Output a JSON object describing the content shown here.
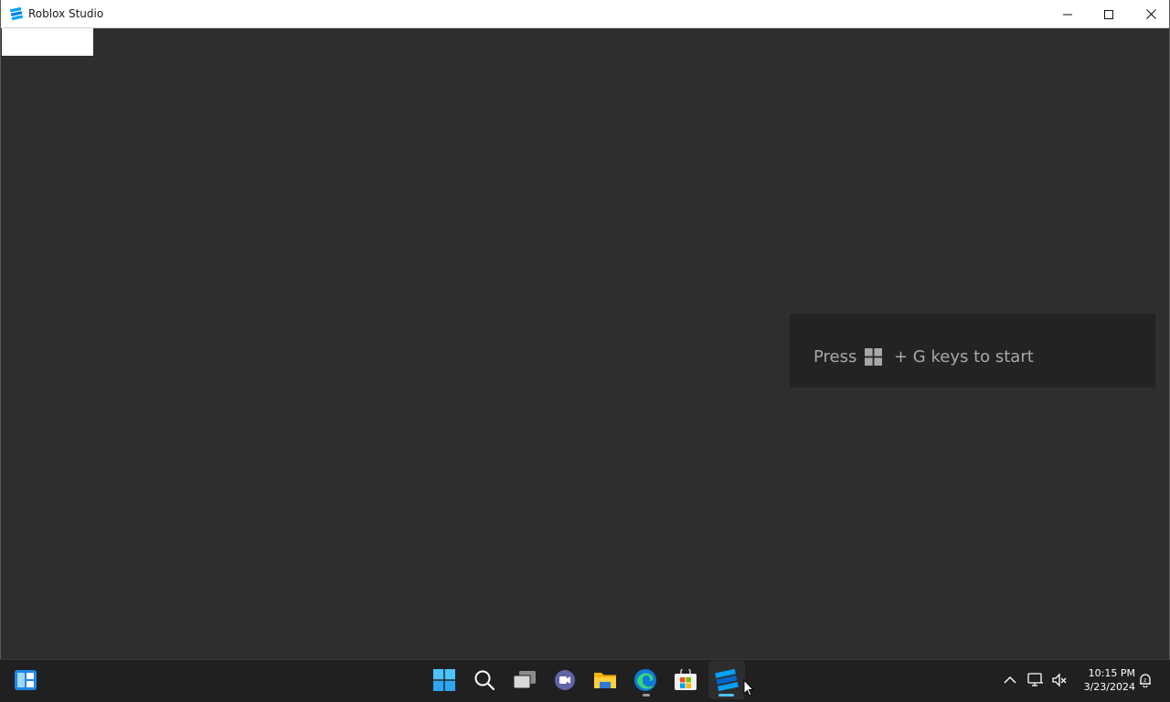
{
  "window": {
    "title": "Roblox Studio",
    "controls": {
      "minimize": "minimize",
      "maximize": "maximize",
      "close": "close"
    }
  },
  "toast": {
    "press": "Press",
    "rest": "+ G keys to start"
  },
  "taskbar": {
    "apps": [
      {
        "name": "Start",
        "icon": "windows-logo-icon"
      },
      {
        "name": "Search",
        "icon": "search-icon"
      },
      {
        "name": "Task View",
        "icon": "task-view-icon"
      },
      {
        "name": "Chat",
        "icon": "teams-chat-icon"
      },
      {
        "name": "File Explorer",
        "icon": "folder-icon"
      },
      {
        "name": "Microsoft Edge",
        "icon": "edge-icon"
      },
      {
        "name": "Microsoft Store",
        "icon": "store-icon"
      },
      {
        "name": "Roblox Studio",
        "icon": "roblox-studio-icon"
      }
    ],
    "clock": {
      "time": "10:15 PM",
      "date": "3/23/2024"
    }
  },
  "colors": {
    "window_bg": "#2e2e2e",
    "taskbar_bg": "#202020",
    "accent": "#4cc2ff",
    "toast_bg": "#232323"
  }
}
